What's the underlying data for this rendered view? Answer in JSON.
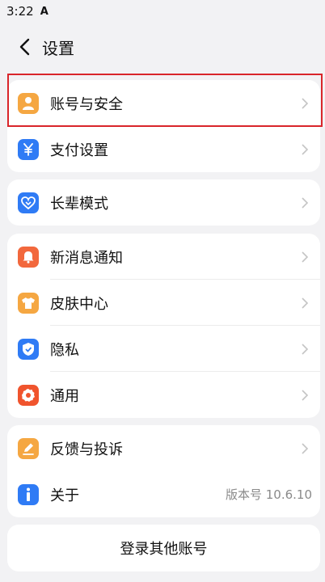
{
  "status_bar": {
    "time": "3:22",
    "indicator": "A"
  },
  "header": {
    "title": "设置"
  },
  "cards": [
    {
      "items": [
        {
          "label": "账号与安全",
          "icon": "person-icon",
          "color": "#f5a742"
        },
        {
          "label": "支付设置",
          "icon": "yuan-icon",
          "color": "#2f7bf5"
        }
      ]
    },
    {
      "items": [
        {
          "label": "长辈模式",
          "icon": "heart-icon",
          "color": "#2f7bf5"
        }
      ]
    },
    {
      "items": [
        {
          "label": "新消息通知",
          "icon": "bell-icon",
          "color": "#f2683d"
        },
        {
          "label": "皮肤中心",
          "icon": "shirt-icon",
          "color": "#f5a742"
        },
        {
          "label": "隐私",
          "icon": "shield-icon",
          "color": "#2f7bf5"
        },
        {
          "label": "通用",
          "icon": "gear-icon",
          "color": "#f0542d"
        }
      ]
    },
    {
      "items": [
        {
          "label": "反馈与投诉",
          "icon": "edit-icon",
          "color": "#f5a742"
        },
        {
          "label": "关于",
          "icon": "info-icon",
          "color": "#2f7bf5",
          "value": "版本号 10.6.10"
        }
      ]
    }
  ],
  "login_other": {
    "label": "登录其他账号"
  }
}
